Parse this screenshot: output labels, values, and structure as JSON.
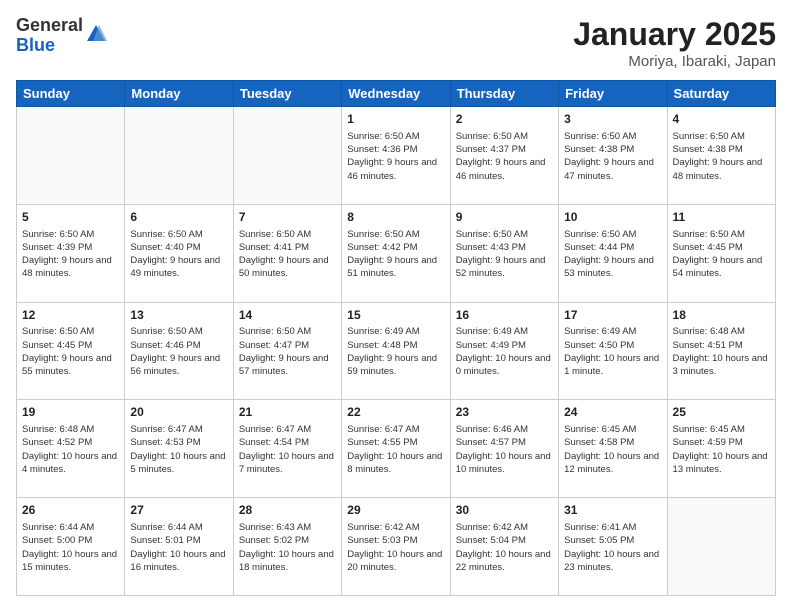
{
  "header": {
    "logo_general": "General",
    "logo_blue": "Blue",
    "month_title": "January 2025",
    "location": "Moriya, Ibaraki, Japan"
  },
  "days_of_week": [
    "Sunday",
    "Monday",
    "Tuesday",
    "Wednesday",
    "Thursday",
    "Friday",
    "Saturday"
  ],
  "weeks": [
    [
      {
        "day": "",
        "info": ""
      },
      {
        "day": "",
        "info": ""
      },
      {
        "day": "",
        "info": ""
      },
      {
        "day": "1",
        "info": "Sunrise: 6:50 AM\nSunset: 4:36 PM\nDaylight: 9 hours and 46 minutes."
      },
      {
        "day": "2",
        "info": "Sunrise: 6:50 AM\nSunset: 4:37 PM\nDaylight: 9 hours and 46 minutes."
      },
      {
        "day": "3",
        "info": "Sunrise: 6:50 AM\nSunset: 4:38 PM\nDaylight: 9 hours and 47 minutes."
      },
      {
        "day": "4",
        "info": "Sunrise: 6:50 AM\nSunset: 4:38 PM\nDaylight: 9 hours and 48 minutes."
      }
    ],
    [
      {
        "day": "5",
        "info": "Sunrise: 6:50 AM\nSunset: 4:39 PM\nDaylight: 9 hours and 48 minutes."
      },
      {
        "day": "6",
        "info": "Sunrise: 6:50 AM\nSunset: 4:40 PM\nDaylight: 9 hours and 49 minutes."
      },
      {
        "day": "7",
        "info": "Sunrise: 6:50 AM\nSunset: 4:41 PM\nDaylight: 9 hours and 50 minutes."
      },
      {
        "day": "8",
        "info": "Sunrise: 6:50 AM\nSunset: 4:42 PM\nDaylight: 9 hours and 51 minutes."
      },
      {
        "day": "9",
        "info": "Sunrise: 6:50 AM\nSunset: 4:43 PM\nDaylight: 9 hours and 52 minutes."
      },
      {
        "day": "10",
        "info": "Sunrise: 6:50 AM\nSunset: 4:44 PM\nDaylight: 9 hours and 53 minutes."
      },
      {
        "day": "11",
        "info": "Sunrise: 6:50 AM\nSunset: 4:45 PM\nDaylight: 9 hours and 54 minutes."
      }
    ],
    [
      {
        "day": "12",
        "info": "Sunrise: 6:50 AM\nSunset: 4:45 PM\nDaylight: 9 hours and 55 minutes."
      },
      {
        "day": "13",
        "info": "Sunrise: 6:50 AM\nSunset: 4:46 PM\nDaylight: 9 hours and 56 minutes."
      },
      {
        "day": "14",
        "info": "Sunrise: 6:50 AM\nSunset: 4:47 PM\nDaylight: 9 hours and 57 minutes."
      },
      {
        "day": "15",
        "info": "Sunrise: 6:49 AM\nSunset: 4:48 PM\nDaylight: 9 hours and 59 minutes."
      },
      {
        "day": "16",
        "info": "Sunrise: 6:49 AM\nSunset: 4:49 PM\nDaylight: 10 hours and 0 minutes."
      },
      {
        "day": "17",
        "info": "Sunrise: 6:49 AM\nSunset: 4:50 PM\nDaylight: 10 hours and 1 minute."
      },
      {
        "day": "18",
        "info": "Sunrise: 6:48 AM\nSunset: 4:51 PM\nDaylight: 10 hours and 3 minutes."
      }
    ],
    [
      {
        "day": "19",
        "info": "Sunrise: 6:48 AM\nSunset: 4:52 PM\nDaylight: 10 hours and 4 minutes."
      },
      {
        "day": "20",
        "info": "Sunrise: 6:47 AM\nSunset: 4:53 PM\nDaylight: 10 hours and 5 minutes."
      },
      {
        "day": "21",
        "info": "Sunrise: 6:47 AM\nSunset: 4:54 PM\nDaylight: 10 hours and 7 minutes."
      },
      {
        "day": "22",
        "info": "Sunrise: 6:47 AM\nSunset: 4:55 PM\nDaylight: 10 hours and 8 minutes."
      },
      {
        "day": "23",
        "info": "Sunrise: 6:46 AM\nSunset: 4:57 PM\nDaylight: 10 hours and 10 minutes."
      },
      {
        "day": "24",
        "info": "Sunrise: 6:45 AM\nSunset: 4:58 PM\nDaylight: 10 hours and 12 minutes."
      },
      {
        "day": "25",
        "info": "Sunrise: 6:45 AM\nSunset: 4:59 PM\nDaylight: 10 hours and 13 minutes."
      }
    ],
    [
      {
        "day": "26",
        "info": "Sunrise: 6:44 AM\nSunset: 5:00 PM\nDaylight: 10 hours and 15 minutes."
      },
      {
        "day": "27",
        "info": "Sunrise: 6:44 AM\nSunset: 5:01 PM\nDaylight: 10 hours and 16 minutes."
      },
      {
        "day": "28",
        "info": "Sunrise: 6:43 AM\nSunset: 5:02 PM\nDaylight: 10 hours and 18 minutes."
      },
      {
        "day": "29",
        "info": "Sunrise: 6:42 AM\nSunset: 5:03 PM\nDaylight: 10 hours and 20 minutes."
      },
      {
        "day": "30",
        "info": "Sunrise: 6:42 AM\nSunset: 5:04 PM\nDaylight: 10 hours and 22 minutes."
      },
      {
        "day": "31",
        "info": "Sunrise: 6:41 AM\nSunset: 5:05 PM\nDaylight: 10 hours and 23 minutes."
      },
      {
        "day": "",
        "info": ""
      }
    ]
  ]
}
